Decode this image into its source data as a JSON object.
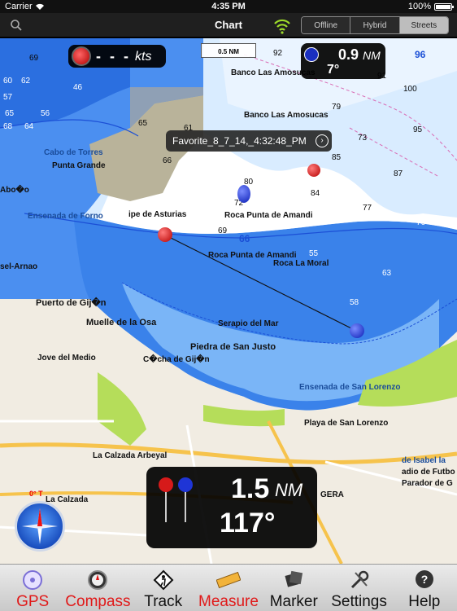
{
  "status_bar": {
    "carrier": "Carrier",
    "time": "4:35 PM",
    "battery": "100%"
  },
  "nav": {
    "title": "Chart",
    "segments": [
      {
        "label": "Offline",
        "active": false
      },
      {
        "label": "Hybrid",
        "active": false
      },
      {
        "label": "Streets",
        "active": true
      }
    ]
  },
  "overlays": {
    "speed": {
      "value": "- - -",
      "unit": "kts"
    },
    "bearing": {
      "distance": "0.9",
      "unit": "NM",
      "degrees": "7°"
    },
    "scale": "0.5 NM",
    "favorite": "Favorite_8_7_14,_4:32:48_PM",
    "measure": {
      "distance": "1.5",
      "unit": "NM",
      "degrees": "117°"
    },
    "compass_north": "0° T"
  },
  "map": {
    "labels": [
      "Banco Las Amosucas",
      "Banco Las Amosucas",
      "Cabo de Torres",
      "Punta Grande",
      "Abo�o",
      "Ensenada de Forno",
      "ipe de Asturias",
      "Roca Punta de Amandi",
      "Roca Punta de Amandi",
      "Roca La Moral",
      "sel-Arnao",
      "Puerto de Gij�n",
      "Muelle de la Osa",
      "Jove del Medio",
      "Serapio del Mar",
      "Piedra de San Justo",
      "C�cha de Gij�n",
      "Ensenada de San Lorenzo",
      "Playa de San Lorenzo",
      "La Calzada Arbeyal",
      "La Calzada",
      "GERA",
      "adio de Futbo",
      "Parador de G",
      "de Isabel la"
    ],
    "depths": [
      "69",
      "62",
      "60",
      "65",
      "57",
      "56",
      "64",
      "68",
      "61",
      "65",
      "66",
      "69",
      "46",
      "80",
      "92",
      "84",
      "79",
      "77",
      "87",
      "91",
      "96",
      "100",
      "85",
      "95",
      "73",
      "72",
      "76",
      "63",
      "66",
      "55",
      "58"
    ]
  },
  "toolbar": {
    "items": [
      {
        "label": "GPS",
        "icon": "gps-icon",
        "highlight": true
      },
      {
        "label": "Compass",
        "icon": "compass-icon",
        "highlight": true
      },
      {
        "label": "Track",
        "icon": "track-icon",
        "highlight": false
      },
      {
        "label": "Measure",
        "icon": "ruler-icon",
        "highlight": true
      },
      {
        "label": "Marker",
        "icon": "marker-icon",
        "highlight": false
      },
      {
        "label": "Settings",
        "icon": "settings-icon",
        "highlight": false
      },
      {
        "label": "Help",
        "icon": "help-icon",
        "highlight": false
      }
    ]
  },
  "colors": {
    "water_deep": "#2b6fe0",
    "water_mid": "#5aa2f0",
    "water_light": "#a7d0ff",
    "land": "#f3efe6",
    "green": "#b5dd5a",
    "highlight_red": "#e01919"
  }
}
